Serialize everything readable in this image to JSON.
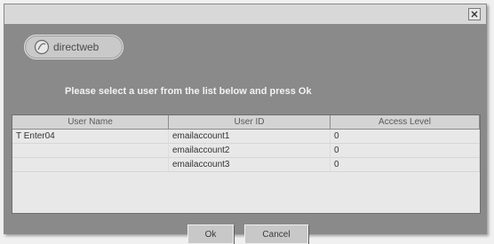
{
  "titlebar": {
    "close_icon": "close-icon"
  },
  "logo": {
    "text": "directweb",
    "icon": "directweb-logo-icon"
  },
  "prompt": "Please select a user from the list below and press Ok",
  "table": {
    "headers": [
      "User Name",
      "User ID",
      "Access Level"
    ],
    "rows": [
      [
        "T Enter04",
        "emailaccount1",
        "0"
      ],
      [
        "",
        "emailaccount2",
        "0"
      ],
      [
        "",
        "emailaccount3",
        "0"
      ]
    ]
  },
  "buttons": {
    "ok": "Ok",
    "cancel": "Cancel"
  }
}
